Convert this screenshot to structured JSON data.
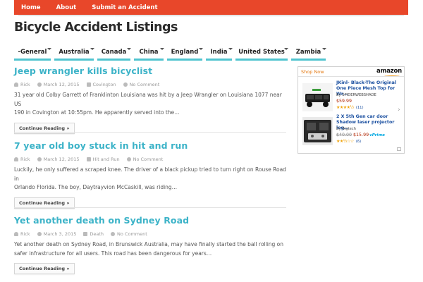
{
  "topnav": {
    "items": [
      "Home",
      "About",
      "Submit an Accident"
    ]
  },
  "site": {
    "title": "Bicycle Accident Listings"
  },
  "categories": [
    "-General",
    "Australia",
    "Canada",
    "China",
    "England",
    "India",
    "United States",
    "Zambia"
  ],
  "posts": [
    {
      "title": "Jeep wrangler kills bicyclist",
      "author": "Rick",
      "date": "March 12, 2015",
      "category": "Covington",
      "comments": "No Comment",
      "excerpt_lines": [
        "31 year old Colby Garrett of Franklinton Louisiana was hit by a Jeep Wrangler on Louisiana 1077 near US",
        "190 in Covington at 10:55pm. He apparently served into the…"
      ],
      "more": "Continue Reading »"
    },
    {
      "title": "7 year old boy stuck in hit and run",
      "author": "Rick",
      "date": "March 12, 2015",
      "category": "Hit and Run",
      "comments": "No Comment",
      "excerpt_lines": [
        "Luckily, he only suffered a scraped knee. The driver of a black pickup tried to turn right on Rouse Road in",
        "Orlando Florida. The boy, Daytrayvion McCaskill, was riding…"
      ],
      "more": "Continue Reading »"
    },
    {
      "title": "Yet another death on Sydney Road",
      "author": "Rick",
      "date": "March 3, 2015",
      "category": "Death",
      "comments": "No Comment",
      "excerpt_lines": [
        "Yet another death on Sydney Road, in Brunswick Australia, may have finally started the ball rolling on",
        "safer infrastructure for all users. This road has been dangerous for years…"
      ],
      "more": "Continue Reading »"
    }
  ],
  "amazon_widget": {
    "shop_now": "Shop Now",
    "logo_text": "amazon",
    "products": [
      {
        "title": "JKinl- Black-The Original One Piece Mesh Top for Wr…",
        "seller": "By SPIDERWEBSHADE",
        "price": "$59.99",
        "old_price": "",
        "prime": "",
        "stars": "★★★★½",
        "reviews": "(11)"
      },
      {
        "title": "2 X 5th Gen car door Shadow laser projector log…",
        "seller": "By Bigtech",
        "price": "$15.99",
        "old_price": "$40.00",
        "prime": "vPrime",
        "stars": "★★½☆☆",
        "reviews": "(6)"
      }
    ]
  },
  "colors": {
    "topbar": "#e8472a",
    "accent": "#3cb3c8",
    "nav_underline": "#4fc3cf"
  }
}
